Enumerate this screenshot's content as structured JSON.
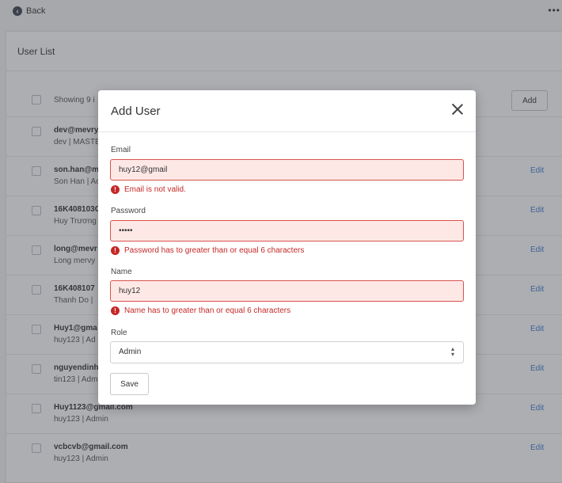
{
  "topbar": {
    "back_label": "Back",
    "more_label": "•••"
  },
  "card": {
    "title": "User List",
    "showing_text": "Showing 9 i",
    "add_label": "Add",
    "rows": [
      {
        "line1": "dev@mevry",
        "line2": "dev | MASTE",
        "edit": ""
      },
      {
        "line1": "son.han@m",
        "line2": "Son Han | Ac",
        "edit": "Edit"
      },
      {
        "line1": "16K408103C",
        "line2": "Huy Trương",
        "edit": "Edit"
      },
      {
        "line1": "long@mevr",
        "line2": "Long mervy",
        "edit": "Edit"
      },
      {
        "line1": "16K408107",
        "line2": "Thanh Do |",
        "edit": "Edit"
      },
      {
        "line1": "Huy1@gma",
        "line2": "huy123 | Ad",
        "edit": "Edit"
      },
      {
        "line1": "nguyendinh",
        "line2": "tin123 | Adm",
        "edit": "Edit"
      },
      {
        "line1": "Huy1123@gmail.com",
        "line2": "huy123 | Admin",
        "edit": "Edit"
      },
      {
        "line1": "vcbcvb@gmail.com",
        "line2": "huy123 | Admin",
        "edit": "Edit"
      }
    ]
  },
  "modal": {
    "title": "Add User",
    "email": {
      "label": "Email",
      "value": "huy12@gmail",
      "error": "Email is not valid."
    },
    "password": {
      "label": "Password",
      "value": "•••••",
      "error": "Password has to greater than or equal 6 characters"
    },
    "name": {
      "label": "Name",
      "value": "huy12",
      "error": "Name has to greater than or equal 6 characters"
    },
    "role": {
      "label": "Role",
      "value": "Admin"
    },
    "save_label": "Save"
  },
  "colors": {
    "error": "#c62828",
    "error_bg": "#fde8e6",
    "link": "#3b7bd4"
  },
  "icons": {
    "back": "back-arrow-icon",
    "close": "close-icon",
    "error": "error-icon",
    "select": "chevron-up-down-icon"
  }
}
